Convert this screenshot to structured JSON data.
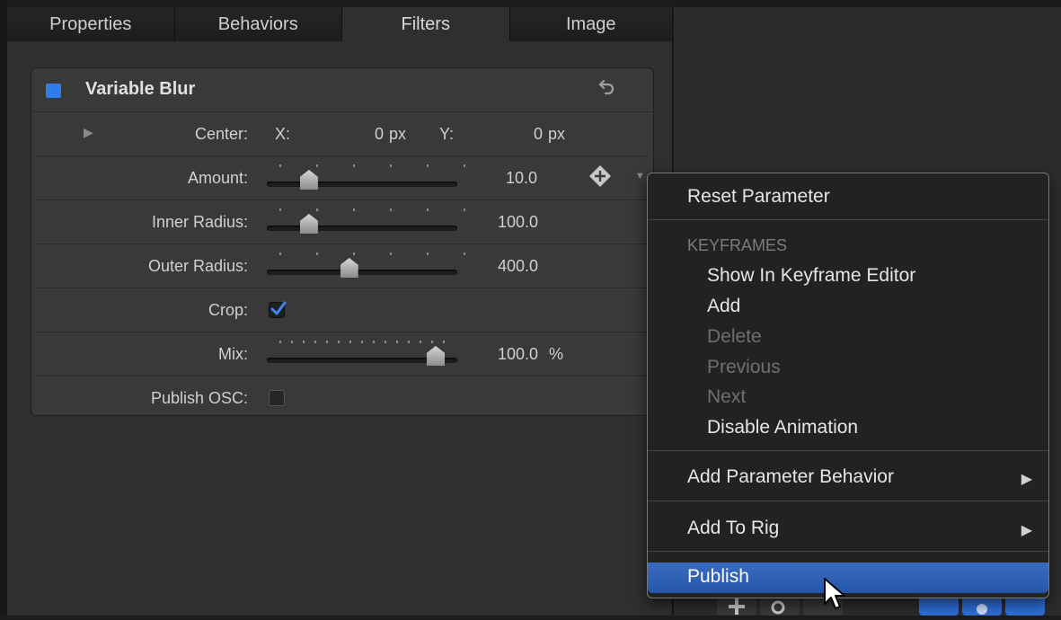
{
  "tabs": [
    {
      "label": "Properties",
      "active": false
    },
    {
      "label": "Behaviors",
      "active": false
    },
    {
      "label": "Filters",
      "active": true
    },
    {
      "label": "Image",
      "active": false
    }
  ],
  "filter": {
    "title": "Variable Blur",
    "enabled": true,
    "accent_color": "#2f7dea",
    "reset_icon": "undo-arrow-icon",
    "center": {
      "label": "Center:",
      "x_label": "X:",
      "x_value": "0",
      "x_unit": "px",
      "y_label": "Y:",
      "y_value": "0",
      "y_unit": "px"
    },
    "amount": {
      "label": "Amount:",
      "value": "10.0",
      "slider_fraction": 0.15
    },
    "inner_radius": {
      "label": "Inner Radius:",
      "value": "100.0",
      "slider_fraction": 0.15
    },
    "outer_radius": {
      "label": "Outer Radius:",
      "value": "400.0",
      "slider_fraction": 0.42
    },
    "crop": {
      "label": "Crop:",
      "checked": true
    },
    "mix": {
      "label": "Mix:",
      "value": "100.0",
      "unit": "%",
      "slider_fraction": 1.0
    },
    "publish_osc": {
      "label": "Publish OSC:",
      "checked": false
    }
  },
  "context_menu": {
    "reset_parameter": "Reset Parameter",
    "keyframes_header": "KEYFRAMES",
    "show_in_keyframe_editor": "Show In Keyframe Editor",
    "add": "Add",
    "delete": "Delete",
    "previous": "Previous",
    "next": "Next",
    "disable_animation": "Disable Animation",
    "add_parameter_behavior": "Add Parameter Behavior",
    "add_to_rig": "Add To Rig",
    "publish": "Publish",
    "highlight_color": "#2f62b5"
  }
}
